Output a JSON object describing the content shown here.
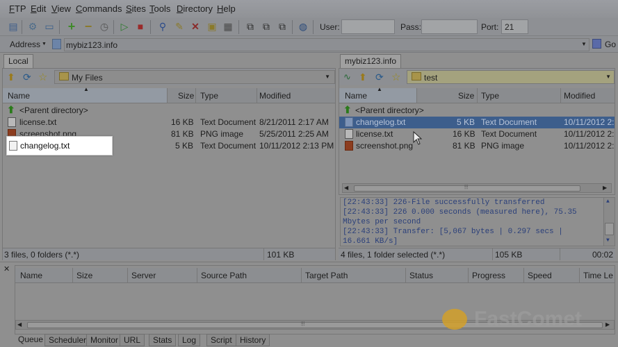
{
  "menu": [
    "FTP",
    "Edit",
    "View",
    "Commands",
    "Sites",
    "Tools",
    "Directory",
    "Help"
  ],
  "menu_accel": [
    "F",
    "E",
    "V",
    "C",
    "S",
    "T",
    "D",
    "H"
  ],
  "toolbar": {
    "user_label": "User:",
    "user_value": "",
    "pass_label": "Pass:",
    "pass_value": "",
    "port_label": "Port:",
    "port_value": "21"
  },
  "address": {
    "label": "Address",
    "value": "mybiz123.info",
    "go": "Go"
  },
  "local": {
    "tab": "Local",
    "path": "My Files",
    "columns": [
      "Name",
      "Size",
      "Type",
      "Modified"
    ],
    "parent": "<Parent directory>",
    "files": [
      {
        "name": "license.txt",
        "size": "16 KB",
        "type": "Text Document",
        "modified": "8/21/2011 2:17 AM",
        "icon": "text"
      },
      {
        "name": "screenshot.png",
        "size": "81 KB",
        "type": "PNG image",
        "modified": "5/25/2011 2:25 AM",
        "icon": "image"
      },
      {
        "name": "changelog.txt",
        "size": "5 KB",
        "type": "Text Document",
        "modified": "10/11/2012 2:13 PM",
        "icon": "text"
      }
    ],
    "status_left": "3 files, 0 folders (*.*)",
    "status_size": "101 KB"
  },
  "remote": {
    "tab": "mybiz123.info",
    "path": "test",
    "columns": [
      "Name",
      "Size",
      "Type",
      "Modified"
    ],
    "parent": "<Parent directory>",
    "files": [
      {
        "name": "changelog.txt",
        "size": "5 KB",
        "type": "Text Document",
        "modified": "10/11/2012 2:",
        "icon": "text",
        "selected": true
      },
      {
        "name": "license.txt",
        "size": "16 KB",
        "type": "Text Document",
        "modified": "10/11/2012 2:",
        "icon": "text"
      },
      {
        "name": "screenshot.png",
        "size": "81 KB",
        "type": "PNG image",
        "modified": "10/11/2012 2:",
        "icon": "image"
      }
    ],
    "status_left": "4 files, 1 folder selected (*.*)",
    "status_size": "105 KB",
    "status_time": "00:02"
  },
  "log": [
    "[22:43:33] 226-File successfully transferred",
    "[22:43:33] 226 0.000 seconds (measured here), 75.35",
    "Mbytes per second",
    "[22:43:33] Transfer: [5,067 bytes | 0.297 secs |",
    "16.661 KB/s]"
  ],
  "queue": {
    "columns": [
      "Name",
      "Size",
      "Server",
      "Source Path",
      "Target Path",
      "Status",
      "Progress",
      "Speed",
      "Time Le"
    ],
    "tabs": [
      "Queue",
      "Scheduler",
      "Monitor",
      "URL",
      "Stats",
      "Log",
      "Script",
      "History"
    ]
  },
  "watermark": "FastComet"
}
